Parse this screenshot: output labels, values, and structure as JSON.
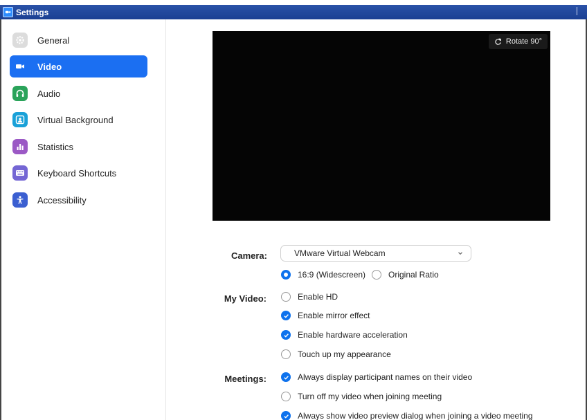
{
  "window": {
    "title": "Settings"
  },
  "sidebar": {
    "items": [
      {
        "label": "General",
        "icon": "gear-icon",
        "color": "#d9d9d9",
        "active": false
      },
      {
        "label": "Video",
        "icon": "video-camera-icon",
        "color": "#1b6ff2",
        "active": true
      },
      {
        "label": "Audio",
        "icon": "headphones-icon",
        "color": "#2aa35a",
        "active": false
      },
      {
        "label": "Virtual Background",
        "icon": "portrait-icon",
        "color": "#1aa1d8",
        "active": false
      },
      {
        "label": "Statistics",
        "icon": "bar-chart-icon",
        "color": "#9b59c5",
        "active": false
      },
      {
        "label": "Keyboard Shortcuts",
        "icon": "keyboard-icon",
        "color": "#7466d4",
        "active": false
      },
      {
        "label": "Accessibility",
        "icon": "accessibility-icon",
        "color": "#3b5fd1",
        "active": false
      }
    ]
  },
  "preview": {
    "rotate_label": "Rotate 90°"
  },
  "camera": {
    "label": "Camera:",
    "selected": "VMware Virtual Webcam",
    "ratio_options": [
      {
        "label": "16:9 (Widescreen)",
        "selected": true
      },
      {
        "label": "Original Ratio",
        "selected": false
      }
    ]
  },
  "my_video": {
    "label": "My Video:",
    "options": [
      {
        "label": "Enable HD",
        "checked": false
      },
      {
        "label": "Enable mirror effect",
        "checked": true
      },
      {
        "label": "Enable hardware acceleration",
        "checked": true
      },
      {
        "label": "Touch up my appearance",
        "checked": false
      }
    ]
  },
  "meetings": {
    "label": "Meetings:",
    "options": [
      {
        "label": "Always display participant names on their video",
        "checked": true
      },
      {
        "label": "Turn off my video when joining meeting",
        "checked": false
      },
      {
        "label": "Always show video preview dialog when joining a video meeting",
        "checked": true
      }
    ]
  },
  "colors": {
    "accent": "#0e72ed",
    "titlebar": "#1a3f93"
  }
}
